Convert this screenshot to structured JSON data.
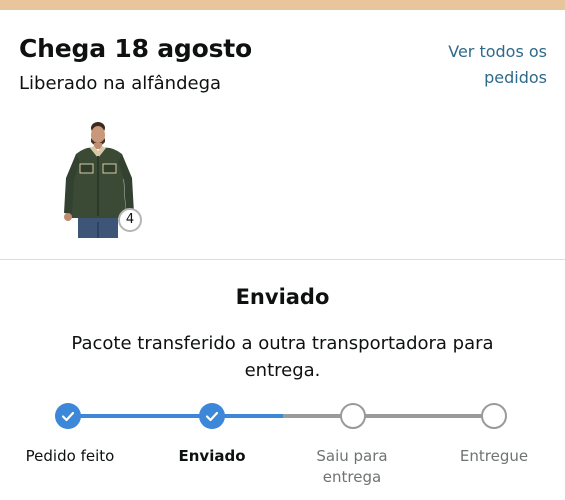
{
  "colors": {
    "accent_top": "#e8c59a",
    "link": "#2f6a8a",
    "progress_done": "#3d87d9",
    "progress_todo": "#9a9a9a"
  },
  "delivery": {
    "title": "Chega 18 agosto",
    "status": "Liberado na alfândega",
    "all_orders_link": "Ver todos os pedidos"
  },
  "product": {
    "image_icon": "green-jacket-product-photo",
    "quantity": "4"
  },
  "shipment": {
    "status_title": "Enviado",
    "status_description": "Pacote transferido a outra transportadora para entrega."
  },
  "tracker": {
    "progress_fraction": 0.44,
    "steps": [
      {
        "label": "Pedido feito",
        "state": "done",
        "icon": "check-icon"
      },
      {
        "label": "Enviado",
        "state": "current",
        "icon": "check-icon"
      },
      {
        "label": "Saiu para entrega",
        "state": "todo"
      },
      {
        "label": "Entregue",
        "state": "todo"
      }
    ]
  }
}
